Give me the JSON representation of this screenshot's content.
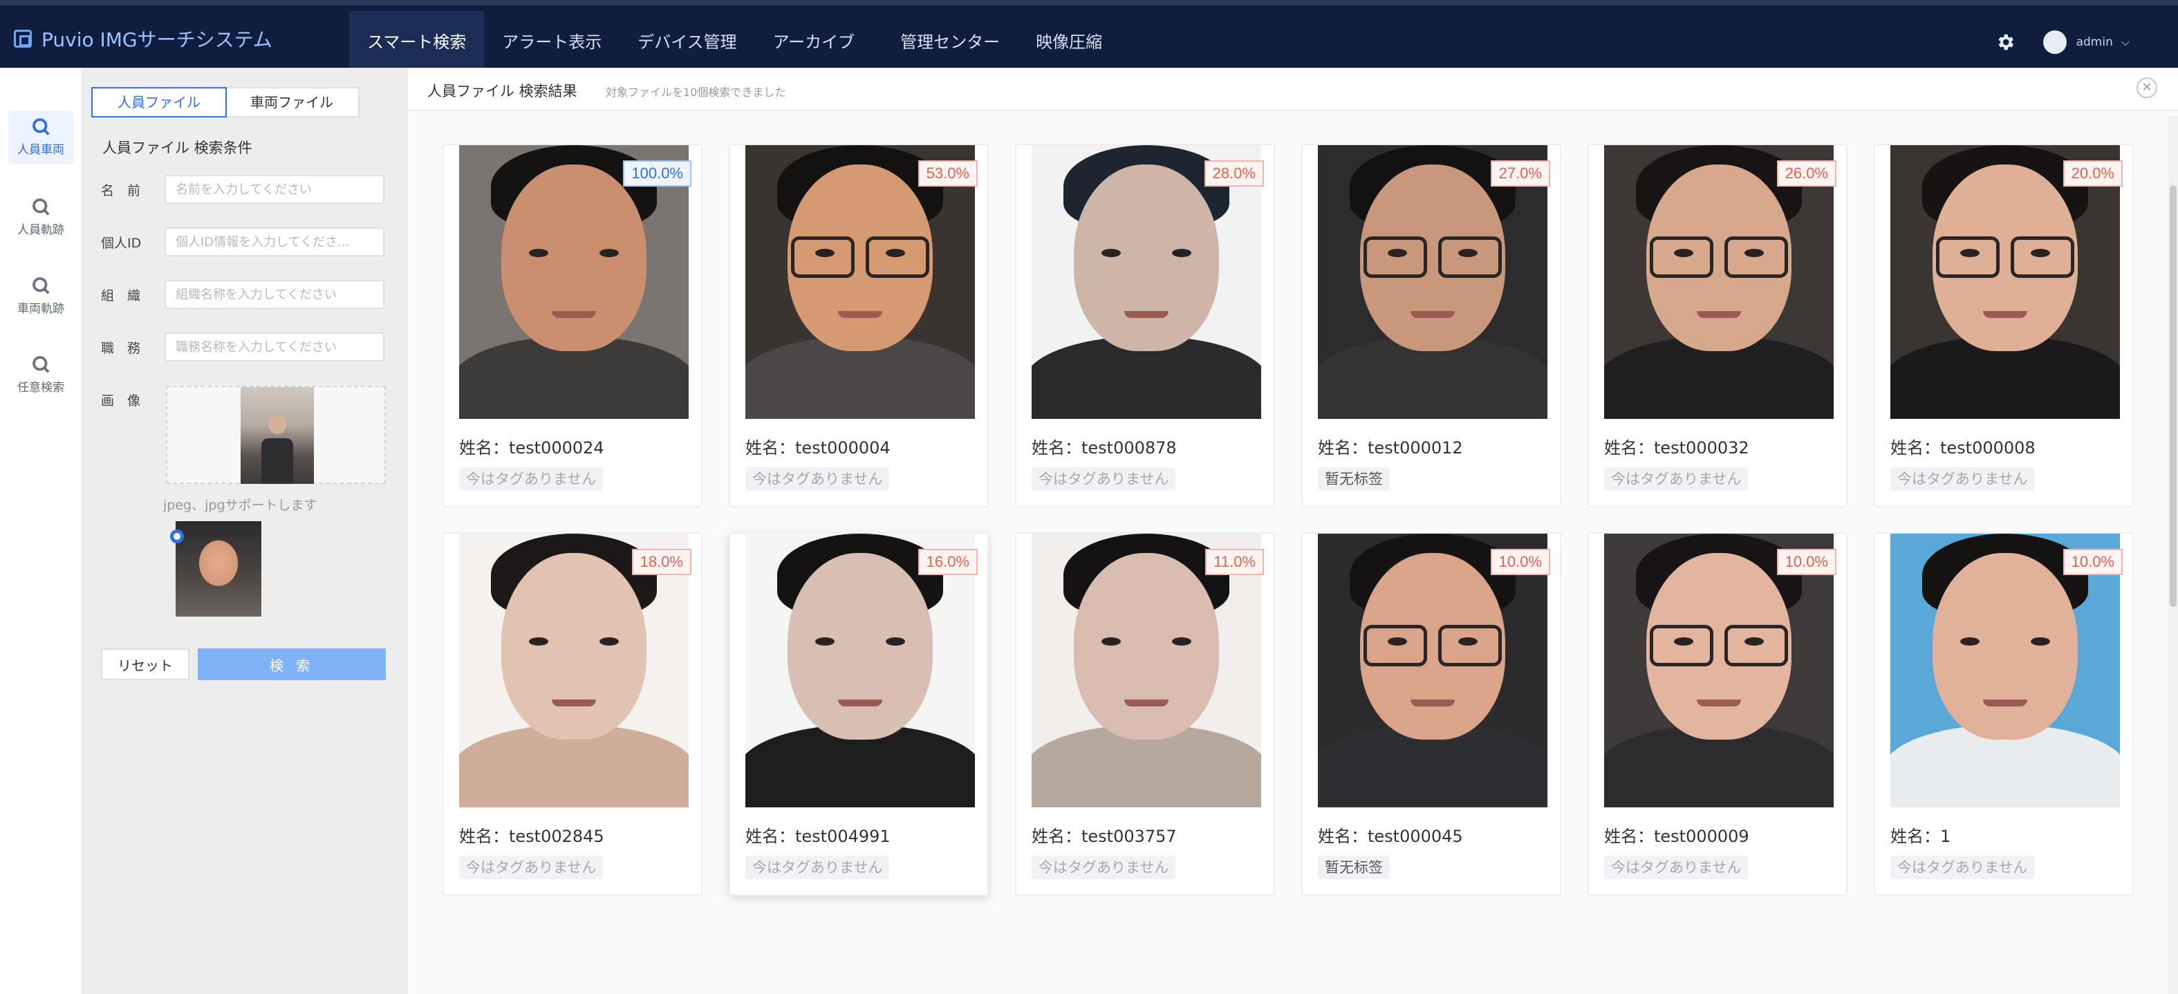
{
  "brand": {
    "title": "Puvio IMGサーチシステム",
    "logo_icon": "window-stack-icon"
  },
  "nav": [
    {
      "label": "スマート検索",
      "active": true
    },
    {
      "label": "アラート表示"
    },
    {
      "label": "デバイス管理"
    },
    {
      "label": "アーカイブ"
    },
    {
      "label": "管理センター"
    },
    {
      "label": "映像圧縮"
    }
  ],
  "user": {
    "name": "admin",
    "settings_icon": "gear-icon"
  },
  "rail": [
    {
      "label": "人員車両",
      "icon": "search-icon",
      "active": true
    },
    {
      "label": "人員軌跡",
      "icon": "search-icon"
    },
    {
      "label": "車両軌跡",
      "icon": "search-icon"
    },
    {
      "label": "任意検索",
      "icon": "search-icon"
    }
  ],
  "filter": {
    "tabs": [
      "人員ファイル",
      "車両ファイル"
    ],
    "title": "人員ファイル 検索条件",
    "fields": [
      {
        "label": "名　前",
        "placeholder": "名前を入力してください"
      },
      {
        "label": "個人ID",
        "placeholder": "個人ID情報を入力してくださ..."
      },
      {
        "label": "組　織",
        "placeholder": "組織名称を入力してください"
      },
      {
        "label": "職　務",
        "placeholder": "職務名称を入力してください"
      }
    ],
    "image_label": "画　像",
    "hint": "jpeg、jpgサポートします",
    "reset": "リセット",
    "search": "検 索"
  },
  "results": {
    "title": "人員ファイル 検索結果",
    "subtitle": "対象ファイルを10個検索できました",
    "close_icon": "close-icon",
    "name_prefix": "姓名：",
    "cards": [
      {
        "name": "姓名：test000024",
        "score": "100.0%",
        "tag": "今はタグありません"
      },
      {
        "name": "姓名：test000004",
        "score": "53.0%",
        "tag": "今はタグありません"
      },
      {
        "name": "姓名：test000878",
        "score": "28.0%",
        "tag": "今はタグありません"
      },
      {
        "name": "姓名：test000012",
        "score": "27.0%",
        "tag": "暂无标签"
      },
      {
        "name": "姓名：test000032",
        "score": "26.0%",
        "tag": "今はタグありません"
      },
      {
        "name": "姓名：test000008",
        "score": "20.0%",
        "tag": "今はタグありません"
      },
      {
        "name": "姓名：test002845",
        "score": "18.0%",
        "tag": "今はタグありません"
      },
      {
        "name": "姓名：test004991",
        "score": "16.0%",
        "tag": "今はタグありません"
      },
      {
        "name": "姓名：test003757",
        "score": "11.0%",
        "tag": "今はタグありません"
      },
      {
        "name": "姓名：test000045",
        "score": "10.0%",
        "tag": "暂无标签"
      },
      {
        "name": "姓名：test000009",
        "score": "10.0%",
        "tag": "今はタグありません"
      },
      {
        "name": "姓名：1",
        "score": "10.0%",
        "tag": "今はタグありません"
      }
    ]
  },
  "colors": {
    "topbar": "#0f1e3f",
    "accent": "#2f6ee8",
    "score_text": "#e8604c"
  }
}
